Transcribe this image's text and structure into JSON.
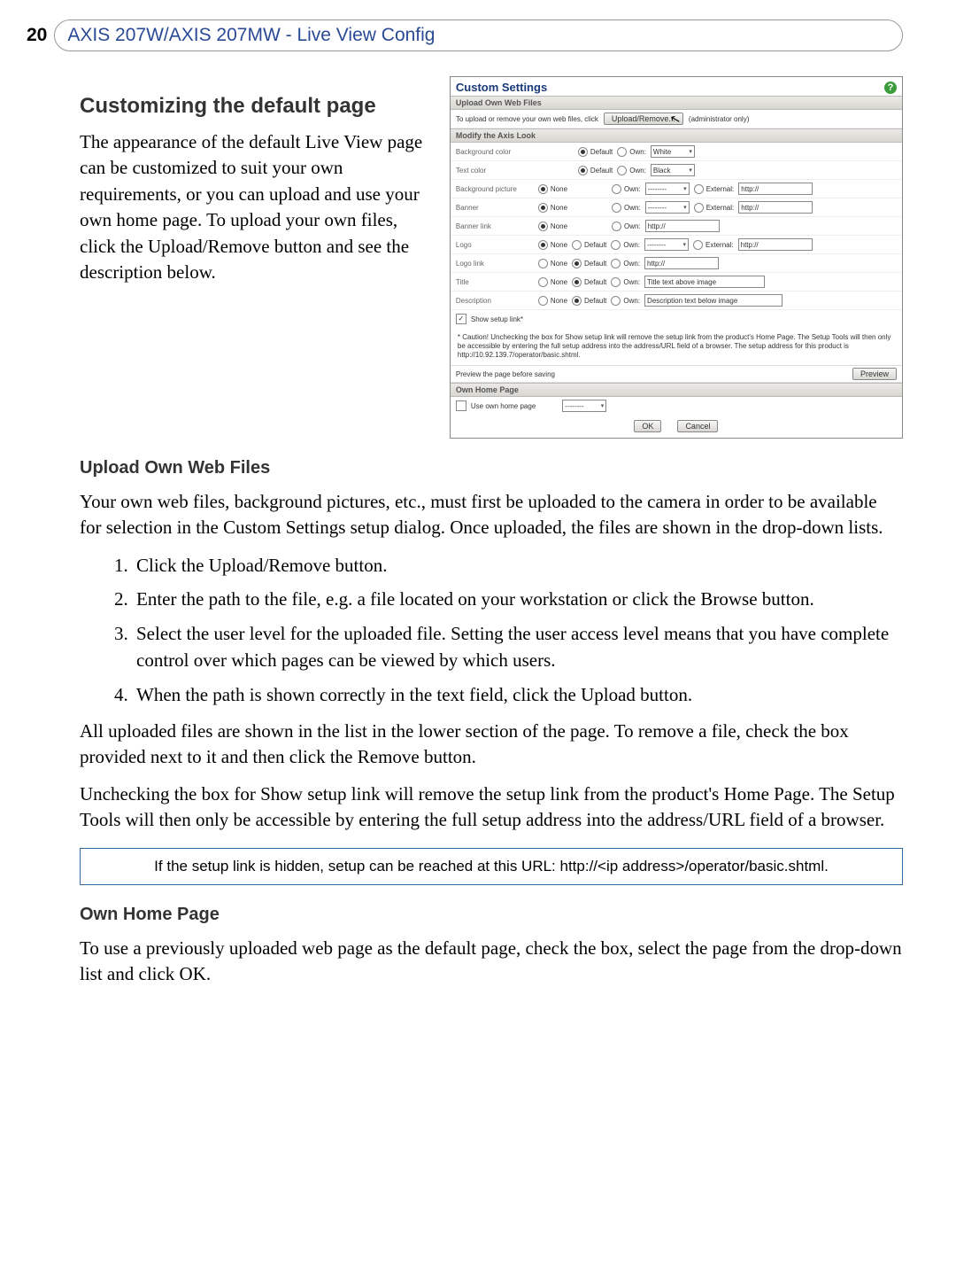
{
  "page_number": "20",
  "header_title": "AXIS 207W/AXIS 207MW - Live View Config",
  "s1_heading": "Customizing the default page",
  "s1_para": "The appearance of the default Live View page can be customized to suit your own requirements, or you can upload and use your own home page. To upload your own files, click the Upload/Remove button and see the description below.",
  "s2_heading": "Upload Own Web Files",
  "s2_para": "Your own web files, background pictures, etc., must first be uploaded to the camera in order to be available for selection in the Custom Settings setup dialog. Once uploaded, the files are shown in the drop-down lists.",
  "steps": [
    "Click the Upload/Remove button.",
    "Enter the path to the file, e.g. a file located on your workstation or click the Browse button.",
    "Select the user level for the uploaded file. Setting the user access level means that you have complete control over which pages can be viewed by which users.",
    "When the path is shown correctly in the text field, click the Upload button."
  ],
  "s2_para2": "All uploaded files are shown in the list in the lower section of the page. To remove a file, check the box provided next to it and then click the Remove button.",
  "s2_para3": "Unchecking the box for Show setup link will remove the setup link from the product's Home Page. The Setup Tools will then only be accessible by entering the full setup address into the address/URL field of a browser.",
  "note": "If the setup link is hidden, setup can be reached at this URL: http://<ip address>/operator/basic.shtml.",
  "s3_heading": "Own Home Page",
  "s3_para": "To use a previously uploaded web page as the default page, check the box, select the page from the drop-down list and click OK.",
  "shot": {
    "title": "Custom Settings",
    "band_upload": "Upload Own Web Files",
    "upload_text": "To upload or remove your own web files, click",
    "upload_btn": "Upload/Remove...",
    "admin_only": "(administrator only)",
    "band_modify": "Modify the Axis Look",
    "r_bg": "Background color",
    "r_text": "Text color",
    "r_bgpic": "Background picture",
    "r_banner": "Banner",
    "r_bannerlink": "Banner link",
    "r_logo": "Logo",
    "r_logolink": "Logo link",
    "r_title": "Title",
    "r_desc": "Description",
    "opt_none": "None",
    "opt_default": "Default",
    "opt_own": "Own:",
    "opt_external": "External:",
    "sel_white": "White",
    "sel_black": "Black",
    "sel_dashes": "--------",
    "inp_http": "http://",
    "inp_title": "Title text above image",
    "inp_desc": "Description text below image",
    "show_setup": "Show setup link*",
    "caution": "* Caution! Unchecking the box for Show setup link will remove the setup link from the product's Home Page. The Setup Tools will then only be accessible by entering the full setup address into the address/URL field of a browser. The setup address for this product is http://10.92.139.7/operator/basic.shtml.",
    "preview_lbl": "Preview the page before saving",
    "preview_btn": "Preview",
    "band_own": "Own Home Page",
    "use_own": "Use own home page",
    "ok": "OK",
    "cancel": "Cancel"
  }
}
